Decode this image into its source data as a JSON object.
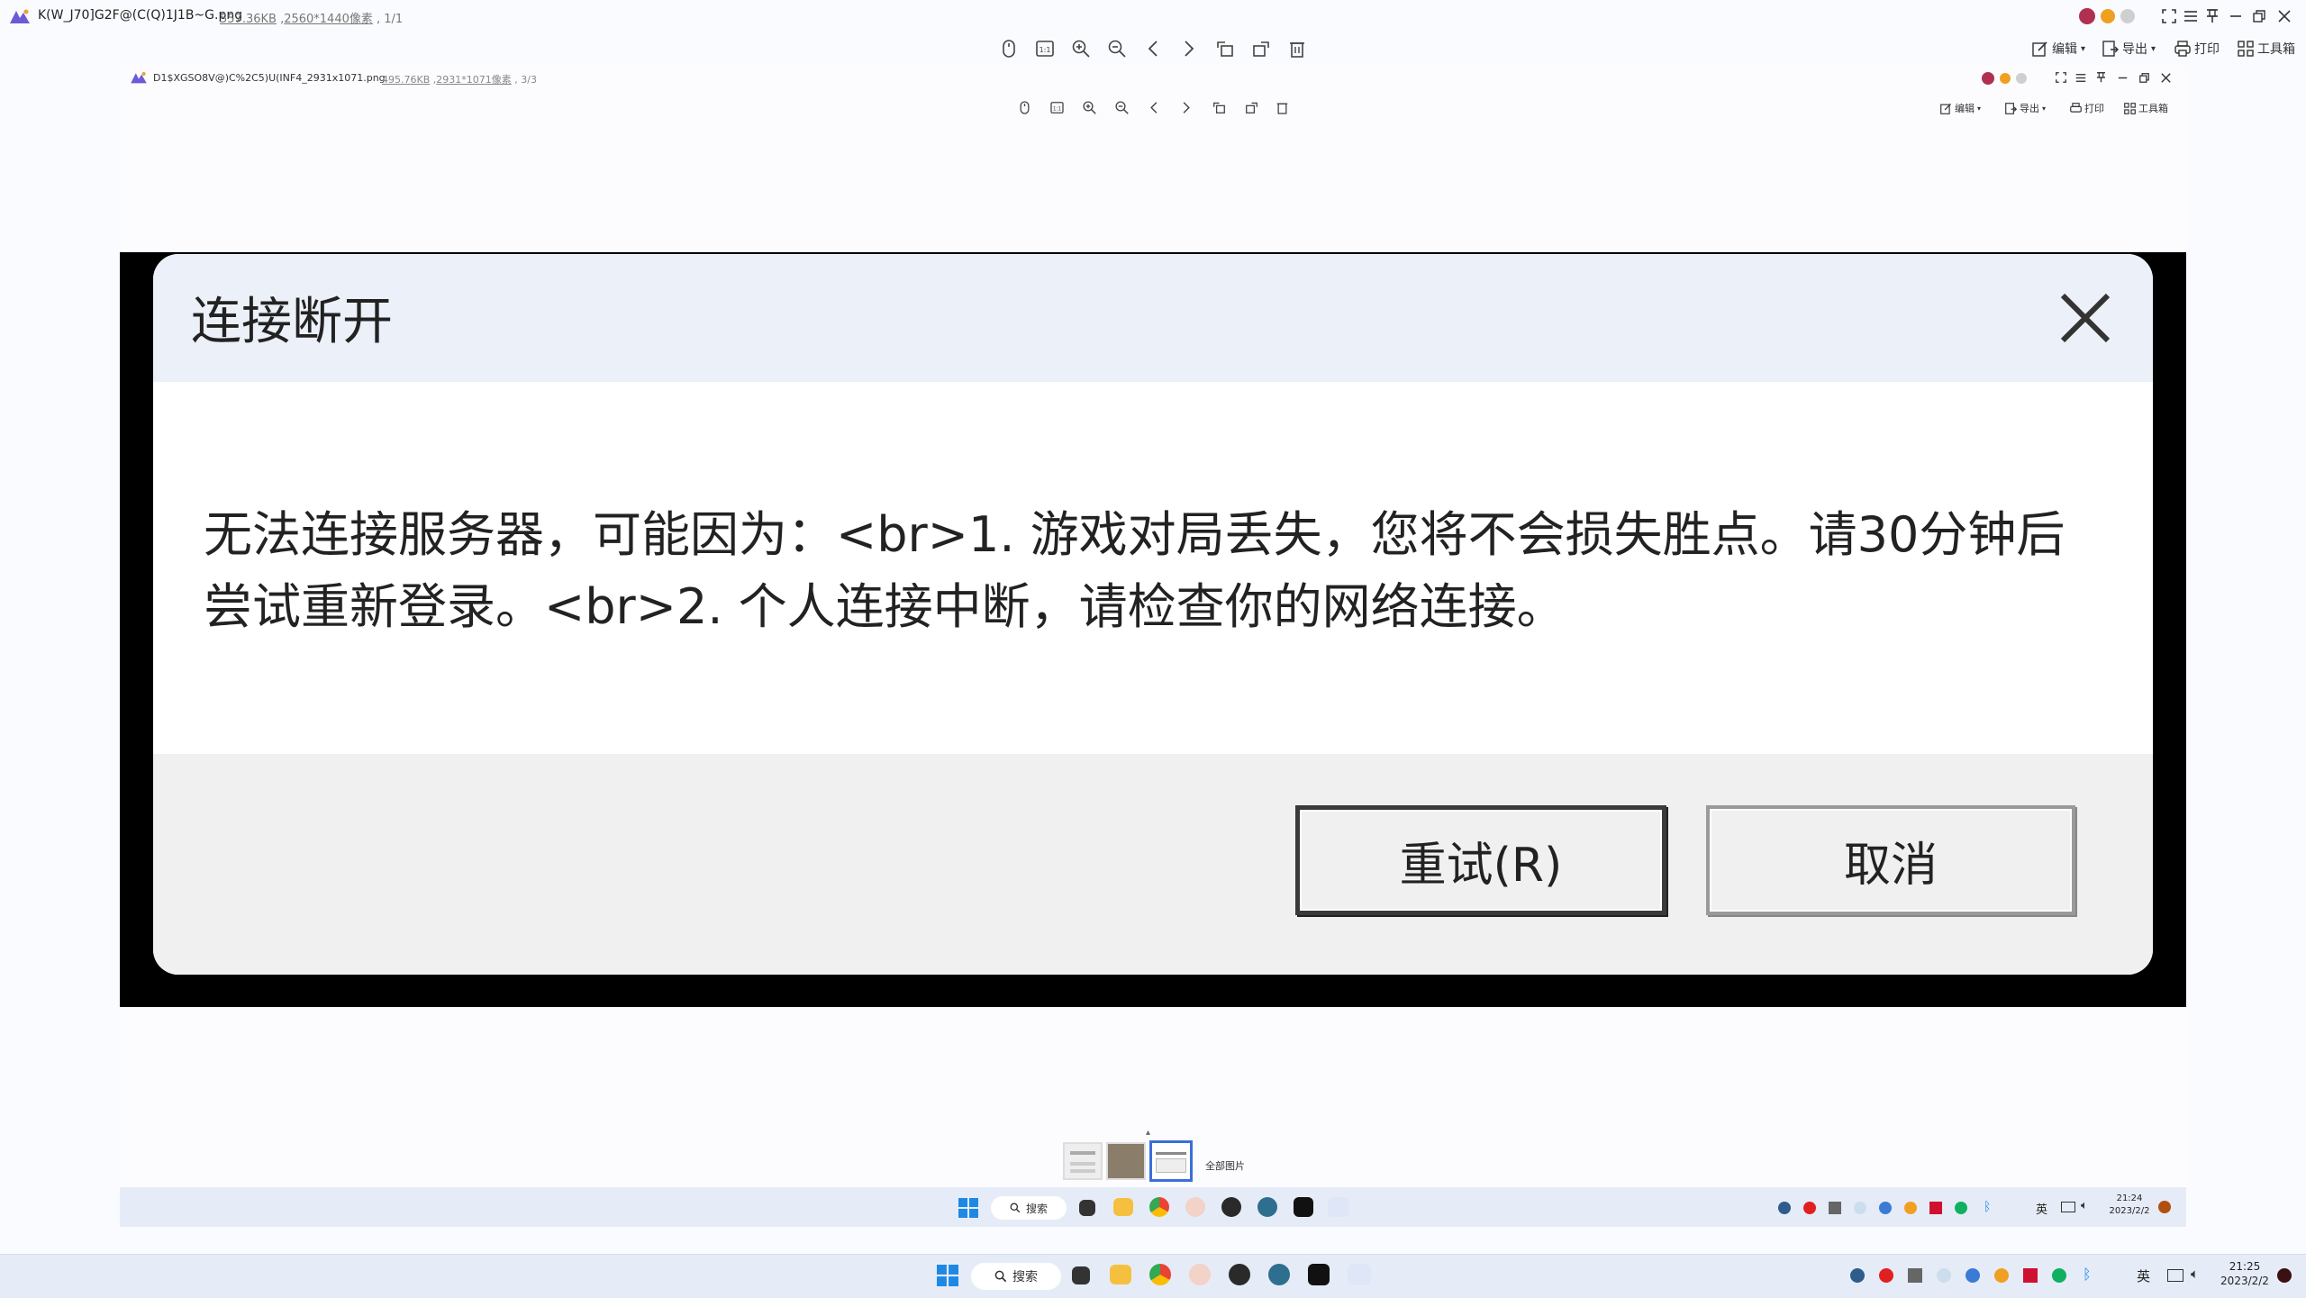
{
  "outer_viewer": {
    "filename": "K(W_J70]G2F@(C(Q)1J1B~G.png",
    "file_size": "557.36KB",
    "dimensions": "2560*1440像素",
    "page_index": "1/1",
    "toolbar_right": {
      "edit_label": "编辑",
      "export_label": "导出",
      "print_label": "打印",
      "tools_label": "工具箱"
    }
  },
  "inner_viewer": {
    "filename": "D1$XGSO8V@)C%2C5)U(INF4_2931x1071.png",
    "file_size": "495.76KB",
    "dimensions": "2931*1071像素",
    "page_index": "3/3",
    "toolbar_right": {
      "edit_label": "编辑",
      "export_label": "导出",
      "print_label": "打印",
      "tools_label": "工具箱"
    },
    "thumbnails_label": "全部图片"
  },
  "dialog": {
    "title": "连接断开",
    "message": "无法连接服务器，可能因为：<br>1. 游戏对局丢失，您将不会损失胜点。请30分钟后尝试重新登录。<br>2. 个人连接中断，请检查你的网络连接。",
    "retry_label": "重试(R)",
    "cancel_label": "取消"
  },
  "inner_taskbar": {
    "search_label": "搜索",
    "ime_label": "英",
    "time": "21:24",
    "date": "2023/2/2"
  },
  "outer_taskbar": {
    "search_label": "搜索",
    "ime_label": "英",
    "time": "21:25",
    "date": "2023/2/2"
  },
  "colors": {
    "windows_blue": "#1e88e5",
    "selection_blue": "#3b6fd9",
    "app_logo_purple": "#6b5bd6"
  }
}
